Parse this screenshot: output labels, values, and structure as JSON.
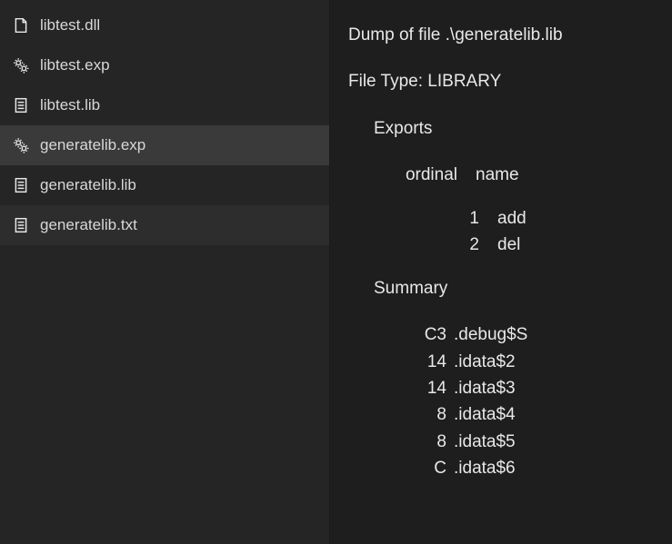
{
  "sidebar": {
    "items": [
      {
        "label": "libtest.dll",
        "icon": "dll",
        "state": ""
      },
      {
        "label": "libtest.exp",
        "icon": "gear",
        "state": ""
      },
      {
        "label": "libtest.lib",
        "icon": "doc",
        "state": ""
      },
      {
        "label": "generatelib.exp",
        "icon": "gear",
        "state": "selected"
      },
      {
        "label": "generatelib.lib",
        "icon": "doc",
        "state": ""
      },
      {
        "label": "generatelib.txt",
        "icon": "doc",
        "state": "hover"
      }
    ]
  },
  "dump": {
    "header_line": "Dump of file .\\generatelib.lib",
    "file_type_line": "File Type: LIBRARY",
    "exports_heading": "Exports",
    "exports_cols": {
      "ordinal": "ordinal",
      "name": "name"
    },
    "exports": [
      {
        "ordinal": "1",
        "name": "add"
      },
      {
        "ordinal": "2",
        "name": "del"
      }
    ],
    "summary_heading": "Summary",
    "summary": [
      {
        "size": "C3",
        "section": ".debug$S"
      },
      {
        "size": "14",
        "section": ".idata$2"
      },
      {
        "size": "14",
        "section": ".idata$3"
      },
      {
        "size": "8",
        "section": ".idata$4"
      },
      {
        "size": "8",
        "section": ".idata$5"
      },
      {
        "size": "C",
        "section": ".idata$6"
      }
    ]
  }
}
